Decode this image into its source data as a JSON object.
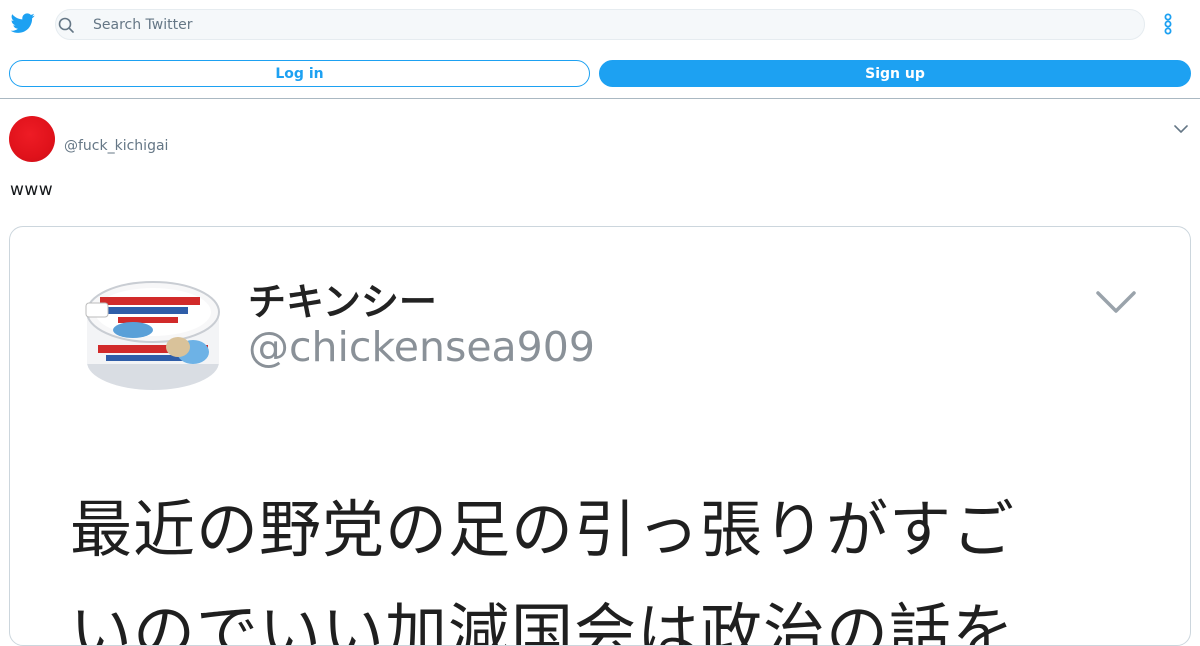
{
  "header": {
    "logo_icon": "twitter-bird-icon",
    "search_placeholder": "Search Twitter",
    "search_icon": "search-icon",
    "more_icon": "vertical-dots-icon",
    "brand_color": "#1da1f2"
  },
  "auth": {
    "login_label": "Log in",
    "signup_label": "Sign up"
  },
  "tweet": {
    "handle": "@fuck_kichigai",
    "text": "www",
    "caret_icon": "chevron-down-icon",
    "avatar_color": "#e0121b"
  },
  "quoted_image": {
    "display_name": "チキンシー",
    "handle": "@chickensea909",
    "caret_icon": "chevron-down-icon",
    "line1": "最近の野党の足の引っ張りがすご",
    "line2": "いのでいい加減国会は政治の話を"
  }
}
